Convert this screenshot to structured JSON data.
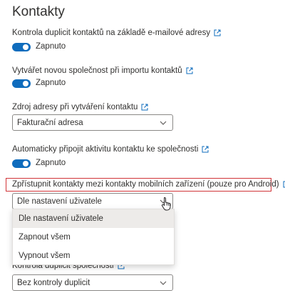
{
  "page": {
    "title": "Kontakty"
  },
  "settings": {
    "dup_email": {
      "label": "Kontrola duplicit kontaktů na základě e-mailové adresy",
      "state": "Zapnuto"
    },
    "new_company": {
      "label": "Vytvářet novou společnost při importu kontaktů",
      "state": "Zapnuto"
    },
    "address_source": {
      "label": "Zdroj adresy při vytváření kontaktu",
      "value": "Fakturační adresa"
    },
    "link_activity": {
      "label": "Automaticky připojit aktivitu kontaktu ke společnosti",
      "state": "Zapnuto"
    },
    "mobile_contacts": {
      "label": "Zpřístupnit kontakty mezi kontakty mobilních zařízení (pouze pro Android)",
      "value": "Dle nastavení uživatele",
      "options": [
        "Dle nastavení uživatele",
        "Zapnout všem",
        "Vypnout všem"
      ]
    },
    "company_dup": {
      "label": "Kontrola duplicit společnosti",
      "value": "Bez kontroly duplicit"
    }
  },
  "colors": {
    "accent": "#0f6cbd",
    "highlight": "#d13438"
  },
  "icons": {
    "external": "external-link-icon",
    "chevron": "chevron-down-icon",
    "cursor": "hand-pointer-icon"
  }
}
